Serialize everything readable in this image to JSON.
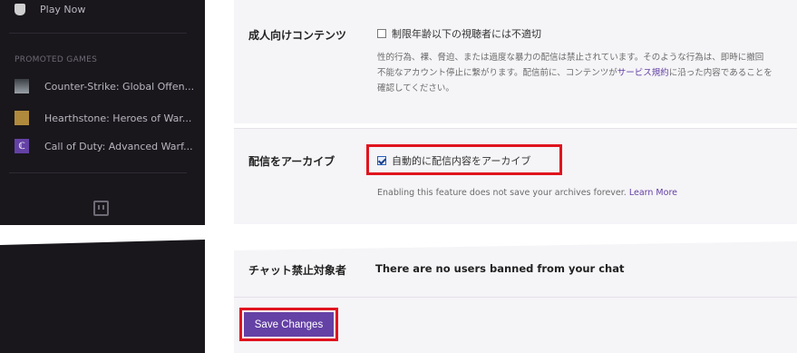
{
  "sidebar": {
    "play_now": "Play Now",
    "promoted_header": "PROMOTED GAMES",
    "games": [
      {
        "name": "Counter-Strike: Global Offen...",
        "icon": "cs-go-thumbnail"
      },
      {
        "name": "Hearthstone: Heroes of War...",
        "icon": "hearthstone-thumbnail"
      },
      {
        "name": "Call of Duty: Advanced Warf...",
        "icon": "cod-thumbnail"
      }
    ]
  },
  "mature": {
    "label": "成人向けコンテンツ",
    "checkbox_label": "制限年齢以下の視聴者には不適切",
    "checked": false,
    "desc_line1": "性的行為、裸、脅迫、または過度な暴力の配信は禁止されています。そのような行為は、即時に撤回",
    "desc_line2_a": "不能なアカウント停止に繋がります。配信前に、コンテンツが",
    "desc_link": "サービス規約",
    "desc_line2_b": "に沿った内容であることを",
    "desc_line3": "確認してください。"
  },
  "archive": {
    "label": "配信をアーカイブ",
    "checkbox_label": "自動的に配信内容をアーカイブ",
    "checked": true,
    "note": "Enabling this feature does not save your archives forever.",
    "learn_more": "Learn More"
  },
  "banned": {
    "label": "チャット禁止対象者",
    "message": "There are no users banned from your chat"
  },
  "save_label": "Save Changes",
  "colors": {
    "accent": "#6441a5",
    "highlight": "#e0141e",
    "sidebar": "#19171c"
  }
}
